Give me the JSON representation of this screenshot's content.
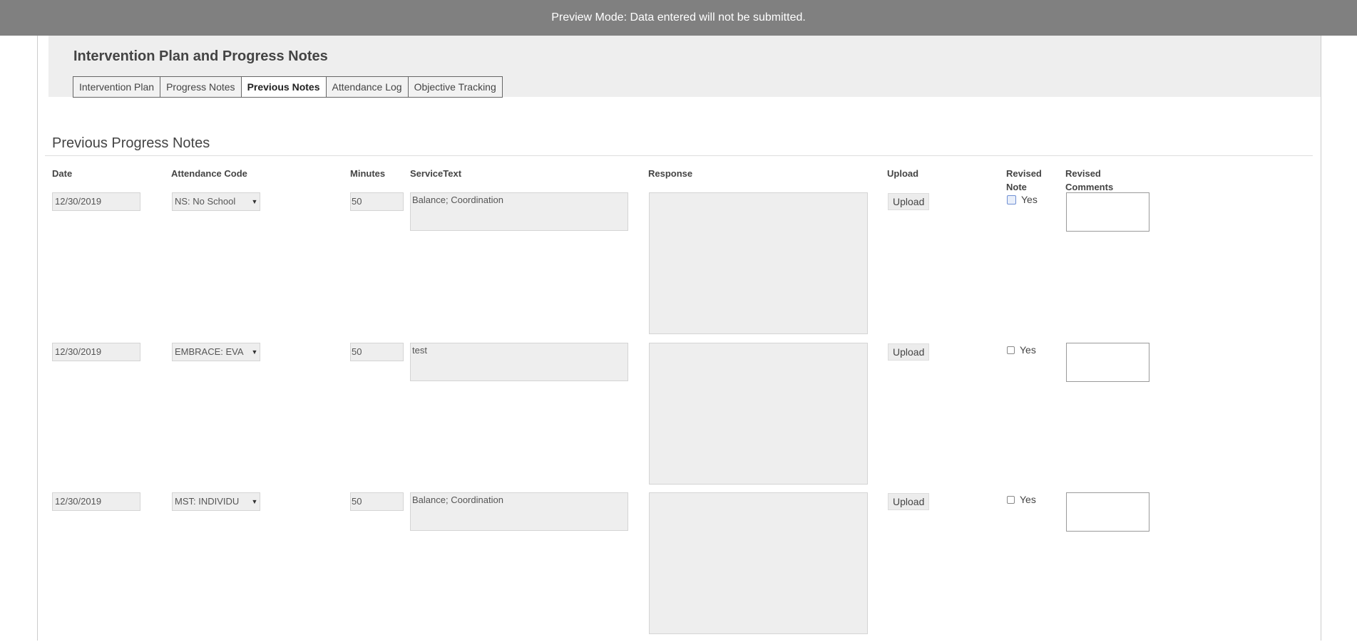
{
  "banner": {
    "text": "Preview Mode: Data entered will not be submitted."
  },
  "page": {
    "title": "Intervention Plan and Progress Notes"
  },
  "tabs": [
    {
      "label": "Intervention Plan"
    },
    {
      "label": "Progress Notes"
    },
    {
      "label": "Previous Notes",
      "active": true
    },
    {
      "label": "Attendance Log"
    },
    {
      "label": "Objective Tracking"
    }
  ],
  "section": {
    "title": "Previous Progress Notes"
  },
  "columns": {
    "date": "Date",
    "attendance_code": "Attendance Code",
    "minutes": "Minutes",
    "service_text": "ServiceText",
    "response": "Response",
    "upload": "Upload",
    "revised_note_1": "Revised",
    "revised_note_2": "Note",
    "revised_comments_1": "Revised",
    "revised_comments_2": "Comments"
  },
  "rows": [
    {
      "date": "12/30/2019",
      "attendance_code": "NS: No School",
      "minutes": "50",
      "service_text": "Balance; Coordination",
      "response": "",
      "upload_label": "Upload",
      "revised_label": "Yes",
      "revised_checked": false
    },
    {
      "date": "12/30/2019",
      "attendance_code": "EMBRACE: EVA",
      "minutes": "50",
      "service_text": "test",
      "response": "",
      "upload_label": "Upload",
      "revised_label": "Yes",
      "revised_checked": false
    },
    {
      "date": "12/30/2019",
      "attendance_code": "MST: INDIVIDU",
      "minutes": "50",
      "service_text": "Balance; Coordination",
      "response": "",
      "upload_label": "Upload",
      "revised_label": "Yes",
      "revised_checked": false
    }
  ]
}
